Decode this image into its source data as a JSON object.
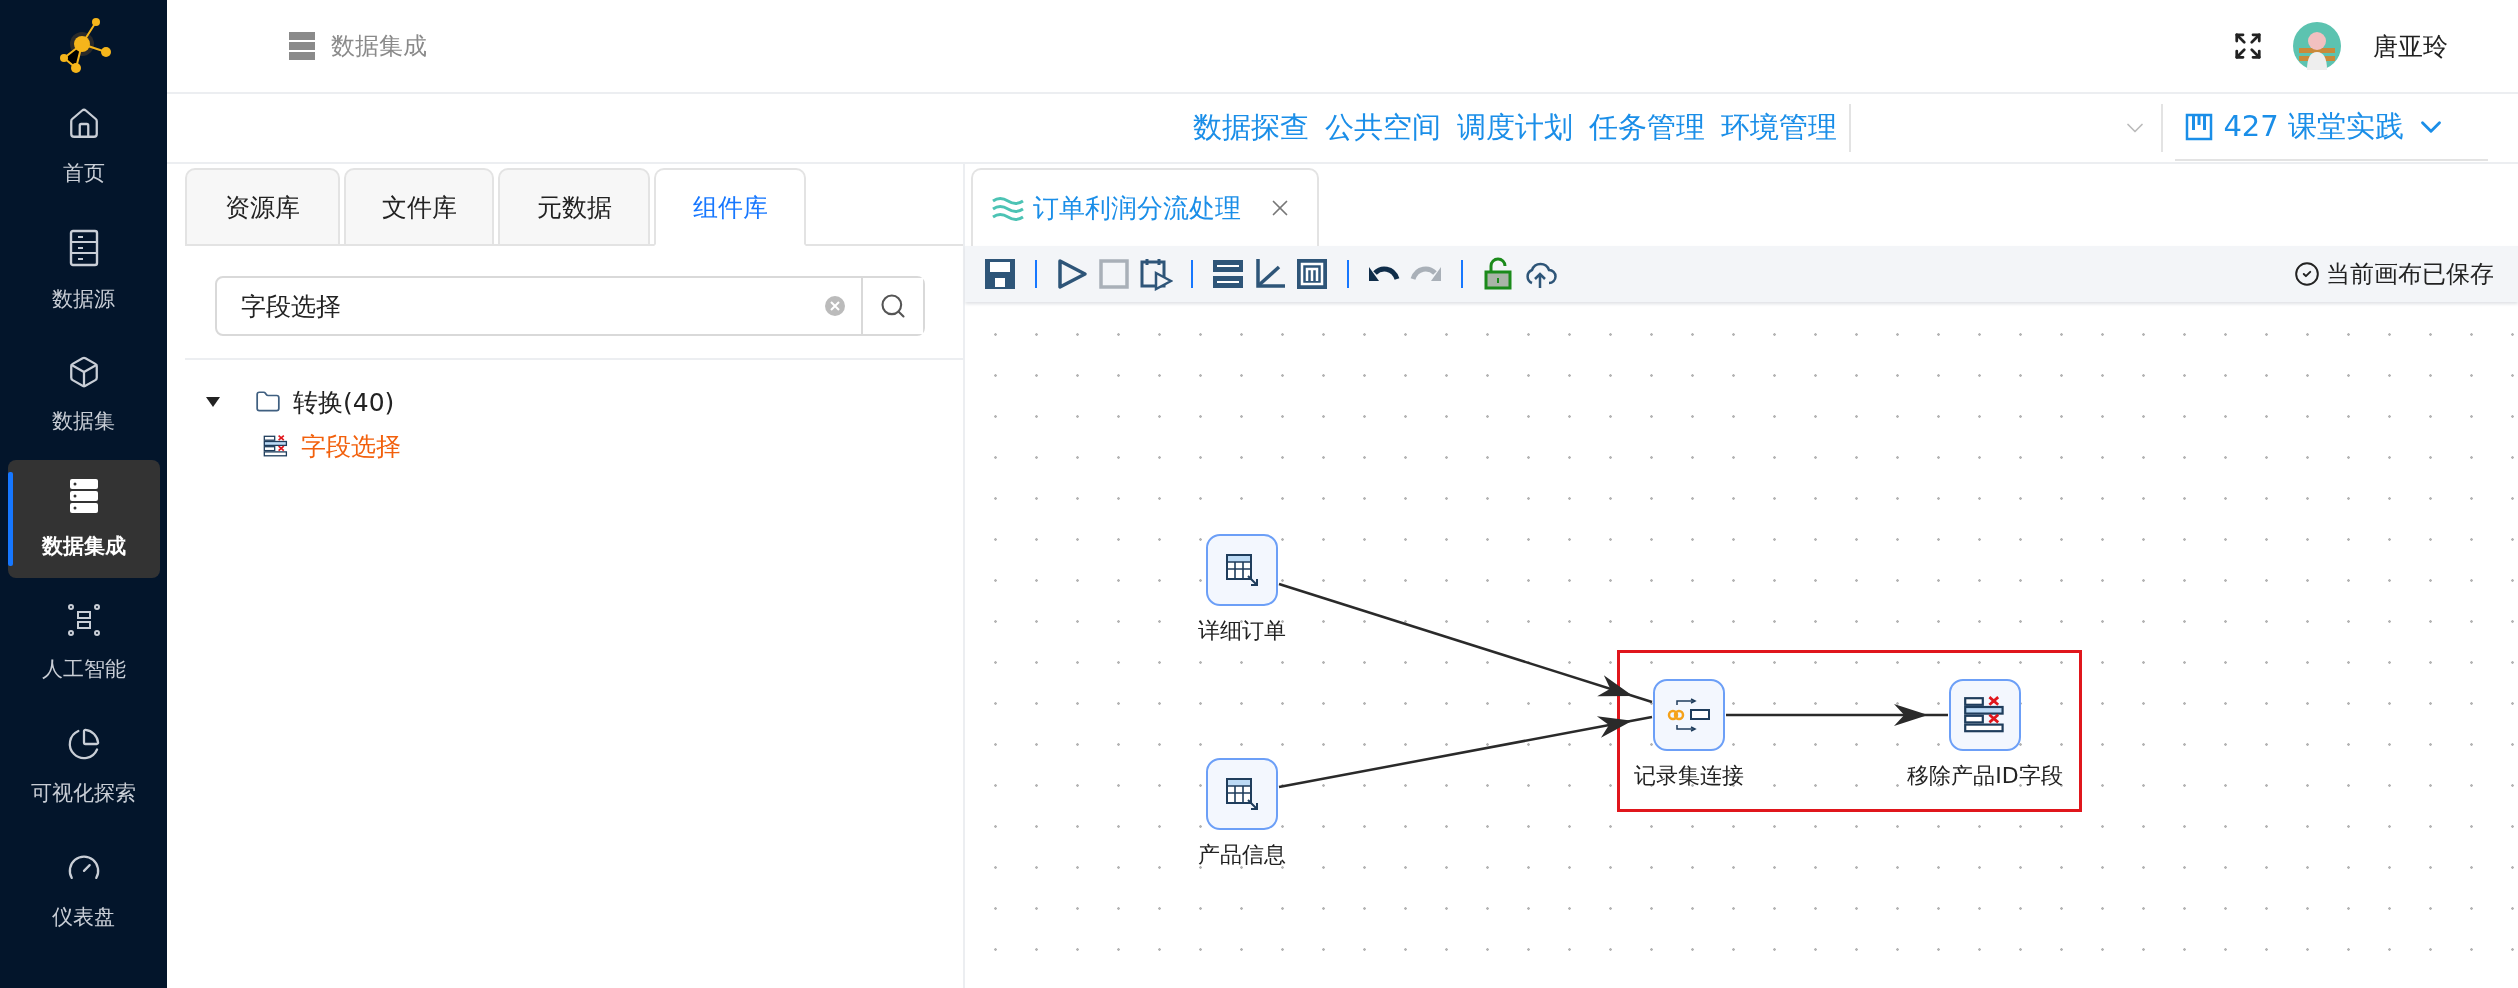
{
  "sidebar": {
    "items": [
      {
        "label": "首页",
        "kind": "home",
        "selected": false
      },
      {
        "label": "数据源",
        "kind": "cabinet",
        "selected": false
      },
      {
        "label": "数据集",
        "kind": "box",
        "selected": false
      },
      {
        "label": "数据集成",
        "kind": "server",
        "selected": true
      },
      {
        "label": "人工智能",
        "kind": "scan",
        "selected": false
      },
      {
        "label": "可视化探索",
        "kind": "pie",
        "selected": false
      },
      {
        "label": "仪表盘",
        "kind": "gauge",
        "selected": false
      }
    ]
  },
  "header": {
    "breadcrumb": "数据集成",
    "user": "唐亚玲"
  },
  "nav": {
    "links": [
      "数据探查",
      "公共空间",
      "调度计划",
      "任务管理",
      "环境管理"
    ],
    "project": "427 课堂实践"
  },
  "left_panel": {
    "tabs": [
      {
        "label": "资源库",
        "selected": false
      },
      {
        "label": "文件库",
        "selected": false
      },
      {
        "label": "元数据",
        "selected": false
      },
      {
        "label": "组件库",
        "selected": true
      }
    ],
    "search": {
      "value": "字段选择"
    },
    "tree": [
      {
        "label": "转换(40)",
        "expanded": true,
        "children": [
          {
            "label": "字段选择",
            "matched": true
          }
        ]
      }
    ]
  },
  "editor": {
    "tabs": [
      {
        "label": "订单利润分流处理",
        "selected": true
      }
    ],
    "toolbar": [
      [
        {
          "kind": "save",
          "disabled": false
        }
      ],
      [
        {
          "kind": "run",
          "disabled": false
        },
        {
          "kind": "stop",
          "disabled": true
        },
        {
          "kind": "schedule",
          "disabled": false
        }
      ],
      [
        {
          "kind": "layout",
          "disabled": false
        },
        {
          "kind": "axis",
          "disabled": false
        },
        {
          "kind": "module",
          "disabled": false
        }
      ],
      [
        {
          "kind": "undo",
          "disabled": false
        },
        {
          "kind": "redo",
          "disabled": true
        }
      ],
      [
        {
          "kind": "unlock",
          "disabled": false
        },
        {
          "kind": "upload",
          "disabled": false
        }
      ]
    ],
    "status": "当前画布已保存",
    "canvas": {
      "highlight_box": true,
      "nodes": [
        {
          "label": "详细订单",
          "kind": "table-input"
        },
        {
          "label": "产品信息",
          "kind": "table-input"
        },
        {
          "label": "记录集连接",
          "kind": "join"
        },
        {
          "label": "移除产品ID字段",
          "kind": "field-remove"
        }
      ]
    }
  }
}
